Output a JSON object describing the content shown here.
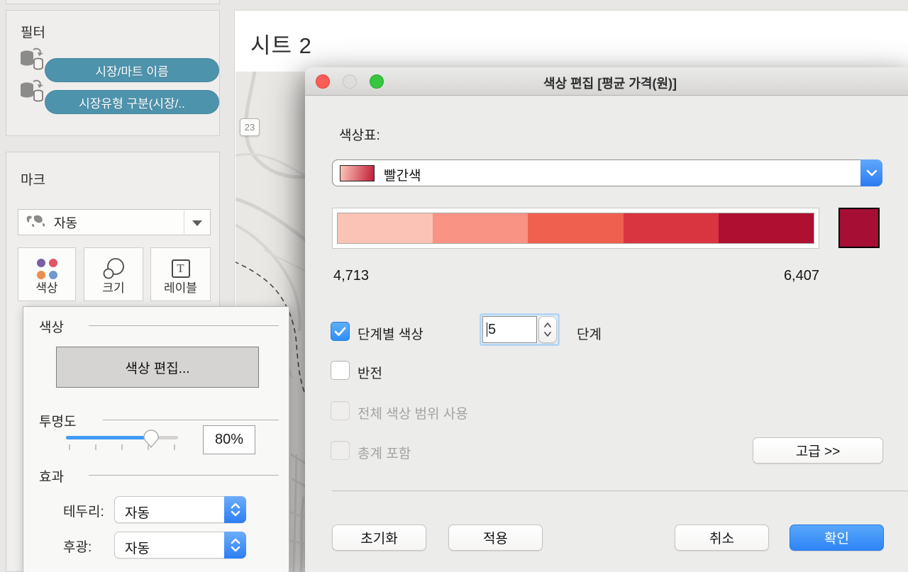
{
  "window": {
    "title": "색상 편집 [평균 가격(원)]"
  },
  "sheet": {
    "title": "시트 2",
    "map_badge": "23"
  },
  "sidebar": {
    "filter_card": {
      "title": "필터",
      "pills": [
        {
          "label": "시장/마트 이름"
        },
        {
          "label": "시장유형 구분(시장/.."
        }
      ]
    },
    "marks_card": {
      "title": "마크",
      "mark_type_label": "자동",
      "buttons": [
        {
          "label": "색상"
        },
        {
          "label": "크기"
        },
        {
          "label": "레이블"
        }
      ]
    }
  },
  "color_popup": {
    "sections": {
      "color": "색상",
      "opacity": "투명도",
      "effects": "효과"
    },
    "edit_colors_label": "색상 편집...",
    "opacity_value": "80%",
    "border_label": "테두리:",
    "border_value": "자동",
    "halo_label": "후광:",
    "halo_value": "자동"
  },
  "dialog": {
    "palette_label": "색상표:",
    "palette_value": "빨간색",
    "min_value": "4,713",
    "max_value": "6,407",
    "stepped_color_label": "단계별 색상",
    "steps_value": "5",
    "steps_unit_label": "단계",
    "reversed_label": "반전",
    "full_color_range_label": "전체 색상 범위 사용",
    "include_totals_label": "총계 포함",
    "advanced_label": "고급 >>",
    "reset_label": "초기화",
    "apply_label": "적용",
    "cancel_label": "취소",
    "ok_label": "확인",
    "gradient_steps": [
      "#fbc3b5",
      "#f99384",
      "#f0604e",
      "#d93540",
      "#ae1031"
    ],
    "current_color": "#a60e33",
    "palette_swatch_gradient": [
      "#fcc8ba",
      "#c21d38"
    ]
  },
  "colors": {
    "accent_blue": "#3f9bf5",
    "pill_teal": "#4e93ac",
    "mark_color_dots": [
      "#7b5fa5",
      "#e25366",
      "#ee8e4e",
      "#6f9ace"
    ]
  }
}
